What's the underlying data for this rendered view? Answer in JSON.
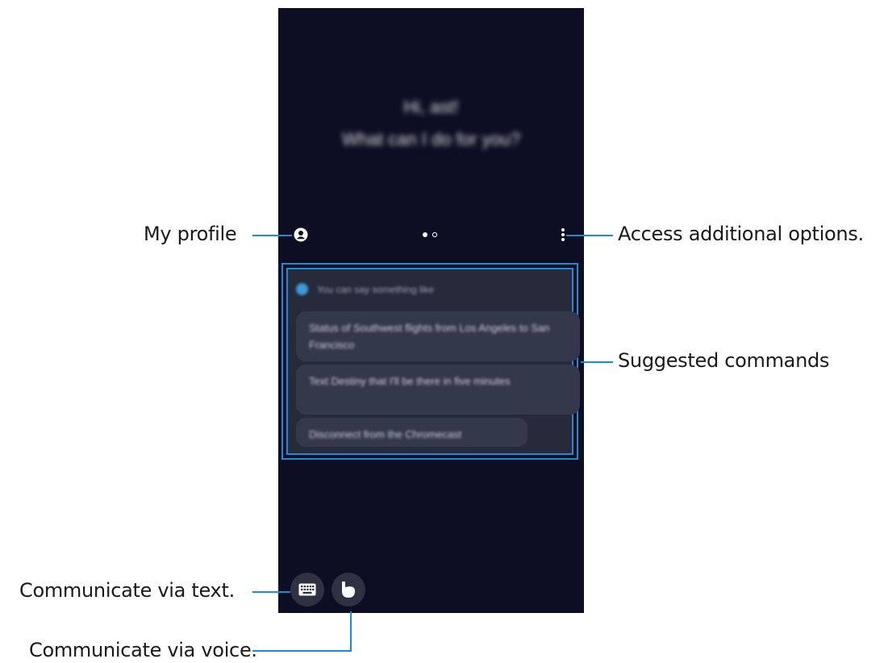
{
  "screen": {
    "greeting": {
      "line1": "Hi, ast!",
      "line2": "What can I do for you?"
    },
    "suggestions": {
      "hint": "You can say something like",
      "commands": [
        "Status of Southwest flights from Los Angeles to San Francisco",
        "Text Destiny that I'll be there in five minutes",
        "Disconnect from the Chromecast"
      ]
    },
    "colors": {
      "background": "#0d0d24",
      "accent": "#1f8bd0",
      "card": "#262a3b"
    }
  },
  "callouts": {
    "my_profile": "My profile",
    "more_options": "Access additional options.",
    "suggested_commands": "Suggested commands",
    "text": "Communicate via text.",
    "voice": "Communicate via voice."
  },
  "icons": [
    "profile-icon",
    "more-options-icon",
    "page-indicator",
    "keyboard-icon",
    "bixby-voice-icon"
  ]
}
